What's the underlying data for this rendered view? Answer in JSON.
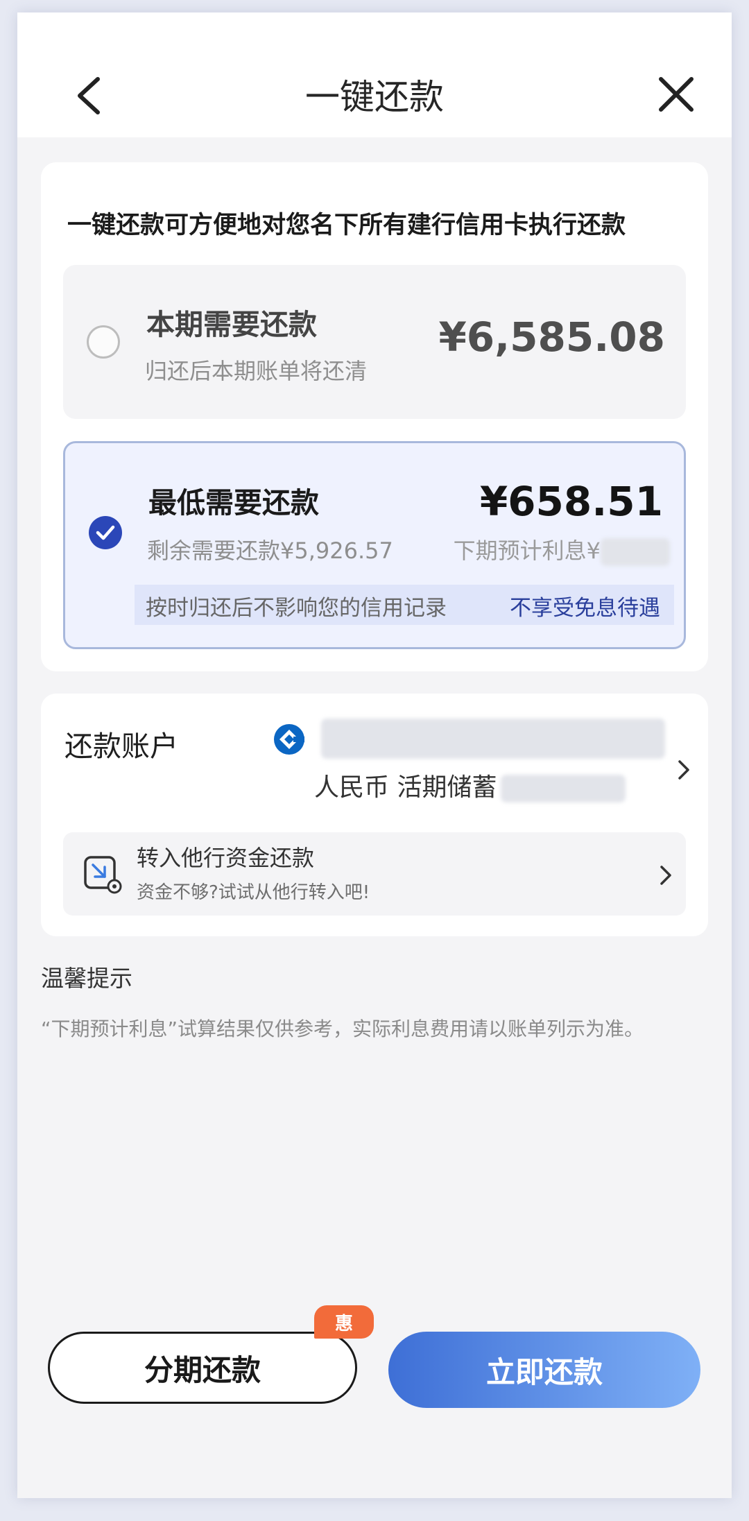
{
  "header": {
    "title": "一键还款"
  },
  "intro": "一键还款可方便地对您名下所有建行信用卡执行还款",
  "options": {
    "full": {
      "label": "本期需要还款",
      "sub": "归还后本期账单将还清",
      "amount": "¥6,585.08",
      "selected": false
    },
    "minimum": {
      "label": "最低需要还款",
      "sub": "剩余需要还款¥5,926.57",
      "amount": "¥658.51",
      "interest_label": "下期预计利息¥",
      "note_left": "按时归还后不影响您的信用记录",
      "note_right": "不享受免息待遇",
      "selected": true
    }
  },
  "account": {
    "label": "还款账户",
    "type": "人民币 活期储蓄"
  },
  "transfer": {
    "title": "转入他行资金还款",
    "subtitle": "资金不够?试试从他行转入吧!"
  },
  "tips": {
    "title": "温馨提示",
    "text": "“下期预计利息”试算结果仅供参考，实际利息费用请以账单列示为准。"
  },
  "buttons": {
    "installment": "分期还款",
    "installment_badge": "惠",
    "pay_now": "立即还款"
  },
  "colors": {
    "accent": "#2b47b8",
    "bank_blue": "#0b66c3",
    "badge": "#f26b3a",
    "primary_gradient_start": "#3e6fd6",
    "primary_gradient_end": "#7fb0f6"
  }
}
